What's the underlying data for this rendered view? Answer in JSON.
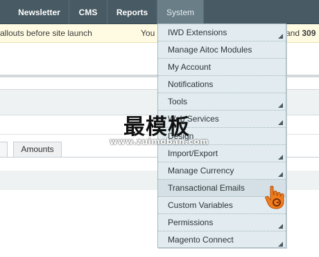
{
  "nav": {
    "items": [
      "Newsletter",
      "CMS",
      "Reports",
      "System"
    ],
    "active": "System"
  },
  "notice": {
    "left_text": "allouts before site launch",
    "mid_text": "You",
    "right_prefix": "and",
    "right_number": "309"
  },
  "tabs": {
    "amounts": "Amounts"
  },
  "system_menu": {
    "items": [
      {
        "label": "IWD Extensions",
        "has_submenu": true
      },
      {
        "label": "Manage Aitoc Modules",
        "has_submenu": false
      },
      {
        "label": "My Account",
        "has_submenu": false
      },
      {
        "label": "Notifications",
        "has_submenu": false
      },
      {
        "label": "Tools",
        "has_submenu": true
      },
      {
        "label": "Web Services",
        "has_submenu": true
      },
      {
        "label": "Design",
        "has_submenu": false
      },
      {
        "label": "Import/Export",
        "has_submenu": true
      },
      {
        "label": "Manage Currency",
        "has_submenu": true
      },
      {
        "label": "Transactional Emails",
        "has_submenu": false
      },
      {
        "label": "Custom Variables",
        "has_submenu": false
      },
      {
        "label": "Permissions",
        "has_submenu": true
      },
      {
        "label": "Magento Connect",
        "has_submenu": true
      }
    ],
    "hovered": "Transactional Emails"
  },
  "watermark": {
    "title": "最模板",
    "url": "www.zuimoban.com"
  },
  "colors": {
    "nav_bg": "#485a63",
    "nav_active": "#6a7e88",
    "menu_bg": "#e2ecf0",
    "notice_bg": "#fffbe3",
    "cursor_orange": "#f07d1d"
  }
}
